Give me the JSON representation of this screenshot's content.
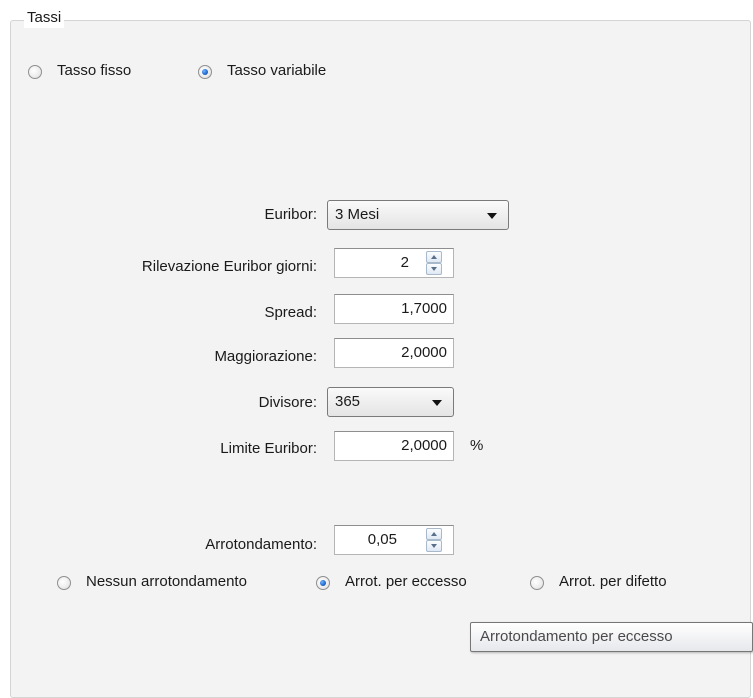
{
  "group": {
    "title": "Tassi"
  },
  "rate_type": {
    "options": [
      {
        "label": "Tasso fisso",
        "selected": false
      },
      {
        "label": "Tasso variabile",
        "selected": true
      }
    ]
  },
  "fields": {
    "euribor": {
      "label": "Euribor:",
      "value": "3 Mesi"
    },
    "rilevazione": {
      "label": "Rilevazione Euribor giorni:",
      "value": "2"
    },
    "spread": {
      "label": "Spread:",
      "value": "1,7000"
    },
    "maggiorazione": {
      "label": "Maggiorazione:",
      "value": "2,0000"
    },
    "divisore": {
      "label": "Divisore:",
      "value": "365"
    },
    "limite_euribor": {
      "label": "Limite Euribor:",
      "value": "2,0000",
      "unit": "%"
    },
    "arrotondamento": {
      "label": "Arrotondamento:",
      "value": "0,05"
    }
  },
  "rounding": {
    "options": [
      {
        "label": "Nessun arrotondamento",
        "selected": false
      },
      {
        "label": "Arrot. per eccesso",
        "selected": true
      },
      {
        "label": "Arrot. per difetto",
        "selected": false
      }
    ]
  },
  "tooltip": {
    "text": "Arrotondamento per eccesso"
  },
  "colors": {
    "selected_radio": "#1f66c9",
    "panel_bg": "#f3f3f3",
    "border": "#d4d4d4"
  },
  "icons": {
    "dropdown": "chevron-down-icon",
    "spinner_up": "arrow-up-icon",
    "spinner_down": "arrow-down-icon"
  }
}
